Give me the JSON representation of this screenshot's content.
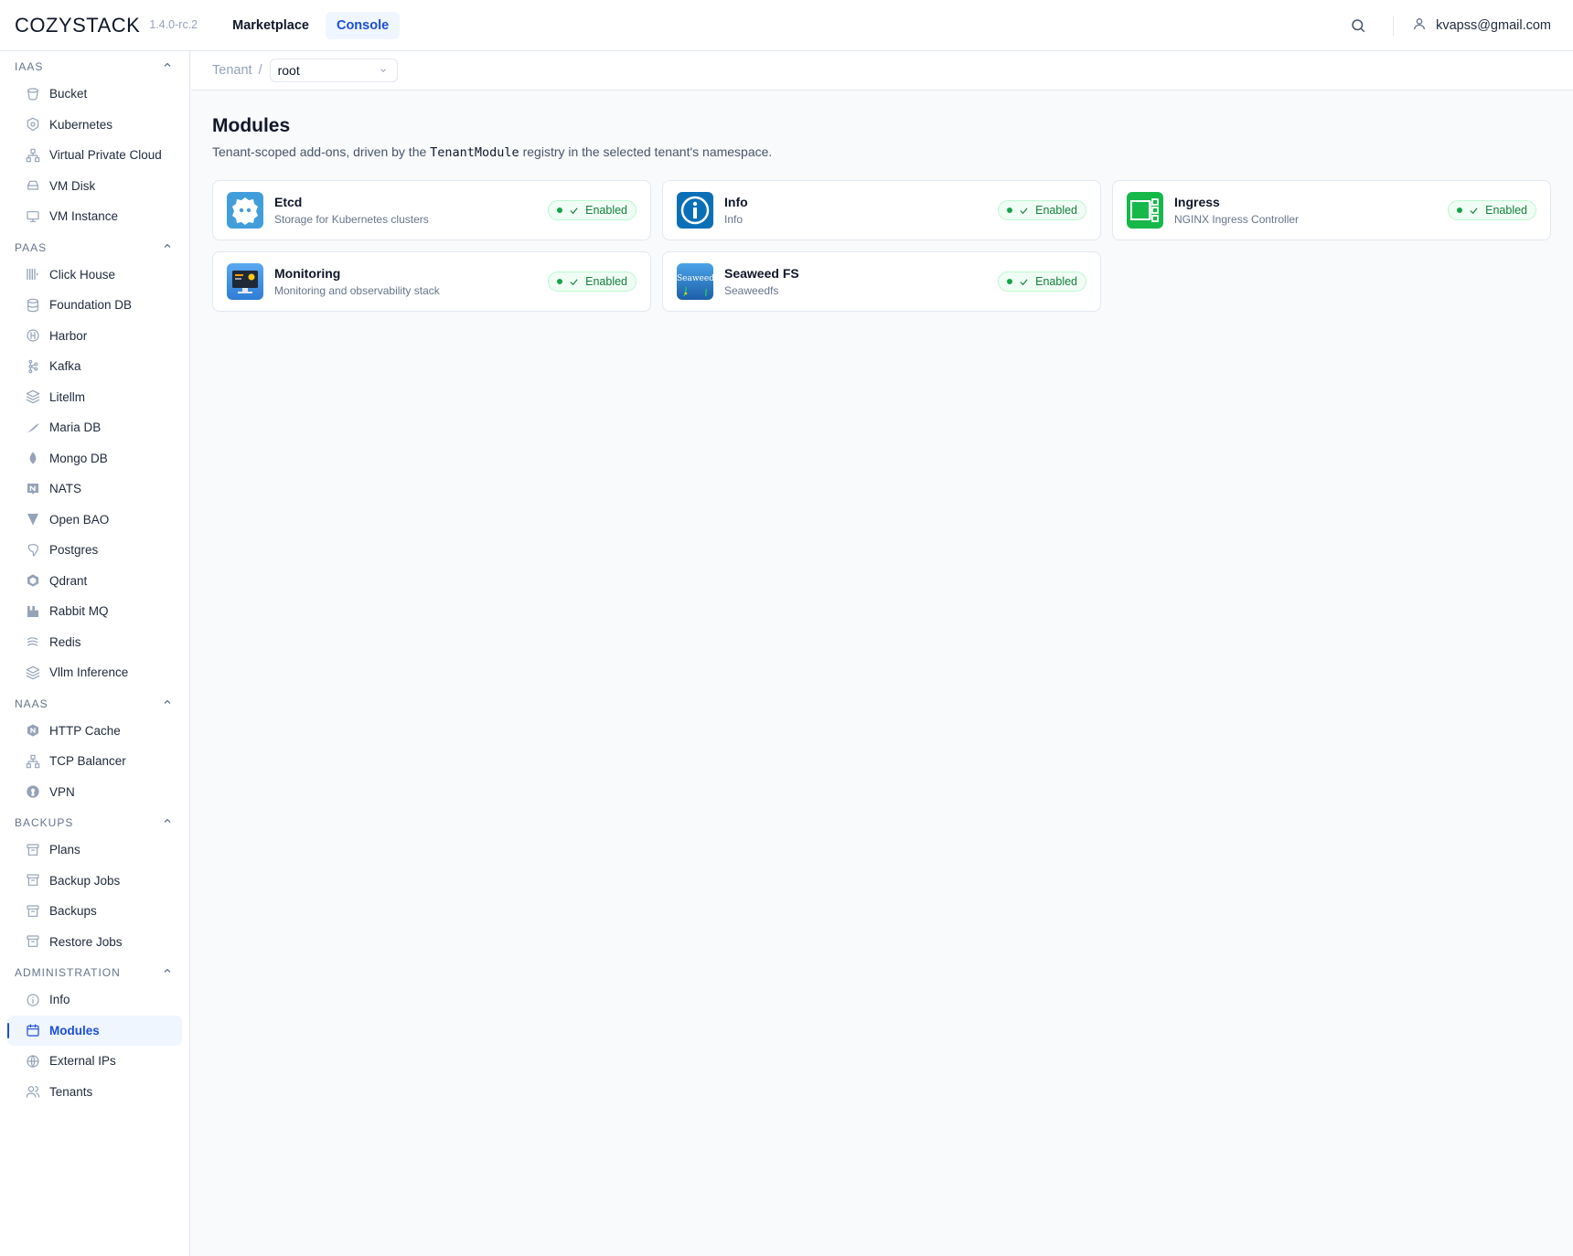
{
  "header": {
    "logo": "COZYSTACK",
    "version": "1.4.0-rc.2",
    "nav": [
      {
        "label": "Marketplace"
      },
      {
        "label": "Console"
      }
    ],
    "user_email": "kvapss@gmail.com"
  },
  "sidebar": {
    "groups": [
      {
        "title": "IAAS",
        "items": [
          {
            "label": "Bucket",
            "icon": "bucket-icon"
          },
          {
            "label": "Kubernetes",
            "icon": "kubernetes-icon"
          },
          {
            "label": "Virtual Private Cloud",
            "icon": "network-icon"
          },
          {
            "label": "VM Disk",
            "icon": "disk-icon"
          },
          {
            "label": "VM Instance",
            "icon": "monitor-icon"
          }
        ]
      },
      {
        "title": "PAAS",
        "items": [
          {
            "label": "Click House",
            "icon": "clickhouse-icon"
          },
          {
            "label": "Foundation DB",
            "icon": "database-icon"
          },
          {
            "label": "Harbor",
            "icon": "harbor-icon"
          },
          {
            "label": "Kafka",
            "icon": "kafka-icon"
          },
          {
            "label": "Litellm",
            "icon": "layers-icon"
          },
          {
            "label": "Maria DB",
            "icon": "mariadb-icon"
          },
          {
            "label": "Mongo DB",
            "icon": "mongodb-icon"
          },
          {
            "label": "NATS",
            "icon": "nats-icon"
          },
          {
            "label": "Open BAO",
            "icon": "openbao-icon"
          },
          {
            "label": "Postgres",
            "icon": "postgres-icon"
          },
          {
            "label": "Qdrant",
            "icon": "qdrant-icon"
          },
          {
            "label": "Rabbit MQ",
            "icon": "rabbitmq-icon"
          },
          {
            "label": "Redis",
            "icon": "redis-icon"
          },
          {
            "label": "Vllm Inference",
            "icon": "layers-icon"
          }
        ]
      },
      {
        "title": "NAAS",
        "items": [
          {
            "label": "HTTP Cache",
            "icon": "nginx-icon"
          },
          {
            "label": "TCP Balancer",
            "icon": "network-icon"
          },
          {
            "label": "VPN",
            "icon": "vpn-icon"
          }
        ]
      },
      {
        "title": "BACKUPS",
        "items": [
          {
            "label": "Plans",
            "icon": "archive-icon"
          },
          {
            "label": "Backup Jobs",
            "icon": "archive-icon"
          },
          {
            "label": "Backups",
            "icon": "archive-icon"
          },
          {
            "label": "Restore Jobs",
            "icon": "archive-icon"
          }
        ]
      },
      {
        "title": "ADMINISTRATION",
        "items": [
          {
            "label": "Info",
            "icon": "info-icon"
          },
          {
            "label": "Modules",
            "icon": "calendar-icon",
            "active": true
          },
          {
            "label": "External IPs",
            "icon": "globe-icon"
          },
          {
            "label": "Tenants",
            "icon": "users-icon"
          }
        ]
      }
    ]
  },
  "breadcrumb": {
    "label": "Tenant",
    "separator": "/",
    "tenant": "root"
  },
  "main": {
    "title": "Modules",
    "subtitle_pre": "Tenant-scoped add-ons, driven by the",
    "subtitle_code": "TenantModule",
    "subtitle_post": "registry in the selected tenant's namespace.",
    "modules": [
      {
        "name": "Etcd",
        "desc": "Storage for Kubernetes clusters",
        "status": "Enabled",
        "icon": "etcd-icon"
      },
      {
        "name": "Info",
        "desc": "Info",
        "status": "Enabled",
        "icon": "info-icon"
      },
      {
        "name": "Ingress",
        "desc": "NGINX Ingress Controller",
        "status": "Enabled",
        "icon": "ingress-icon"
      },
      {
        "name": "Monitoring",
        "desc": "Monitoring and observability stack",
        "status": "Enabled",
        "icon": "monitoring-icon"
      },
      {
        "name": "Seaweed FS",
        "desc": "Seaweedfs",
        "status": "Enabled",
        "icon": "seaweedfs-icon",
        "icon_text": "Seaweed"
      }
    ]
  },
  "colors": {
    "accent": "#1d4ed8",
    "accent_bg": "#eff6ff",
    "success": "#16a34a"
  }
}
